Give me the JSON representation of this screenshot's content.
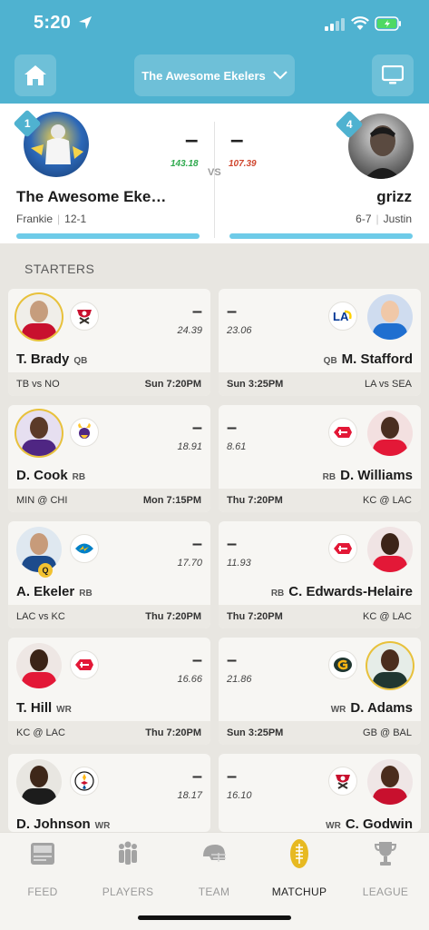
{
  "status_bar": {
    "time": "5:20"
  },
  "header": {
    "team_select_label": "The Awesome Ekelers"
  },
  "matchup": {
    "left": {
      "rank": "1",
      "score": "–",
      "projected": "143.18",
      "team_name": "The Awesome Eke…",
      "owner": "Frankie",
      "record": "12-1",
      "progress": 1.0
    },
    "vs": "VS",
    "right": {
      "rank": "4",
      "score": "–",
      "projected": "107.39",
      "team_name": "grizz",
      "owner": "Justin",
      "record": "6-7",
      "progress": 1.0
    }
  },
  "section": {
    "label": "STARTERS"
  },
  "rows": [
    {
      "left": {
        "name": "T. Brady",
        "pos": "QB",
        "score": "–",
        "proj": "24.39",
        "matchup": "TB vs NO",
        "time": "Sun 7:20PM",
        "team_logo": "buccaneers-logo",
        "highlight": true
      },
      "right": {
        "name": "M. Stafford",
        "pos": "QB",
        "score": "–",
        "proj": "23.06",
        "matchup": "LA vs SEA",
        "time": "Sun 3:25PM",
        "team_logo": "rams-logo",
        "highlight": false
      }
    },
    {
      "left": {
        "name": "D. Cook",
        "pos": "RB",
        "score": "–",
        "proj": "18.91",
        "matchup": "MIN @ CHI",
        "time": "Mon 7:15PM",
        "team_logo": "vikings-logo",
        "highlight": true
      },
      "right": {
        "name": "D. Williams",
        "pos": "RB",
        "score": "–",
        "proj": "8.61",
        "matchup": "KC @ LAC",
        "time": "Thu 7:20PM",
        "team_logo": "chiefs-logo",
        "highlight": false
      }
    },
    {
      "left": {
        "name": "A. Ekeler",
        "pos": "RB",
        "score": "–",
        "proj": "17.70",
        "matchup": "LAC vs KC",
        "time": "Thu 7:20PM",
        "team_logo": "chargers-logo",
        "highlight": false,
        "badge": "Q"
      },
      "right": {
        "name": "C. Edwards-Helaire",
        "pos": "RB",
        "score": "–",
        "proj": "11.93",
        "matchup": "KC @ LAC",
        "time": "Thu 7:20PM",
        "team_logo": "chiefs-logo",
        "highlight": false
      }
    },
    {
      "left": {
        "name": "T. Hill",
        "pos": "WR",
        "score": "–",
        "proj": "16.66",
        "matchup": "KC @ LAC",
        "time": "Thu 7:20PM",
        "team_logo": "chiefs-logo",
        "highlight": false
      },
      "right": {
        "name": "D. Adams",
        "pos": "WR",
        "score": "–",
        "proj": "21.86",
        "matchup": "GB @ BAL",
        "time": "Sun 3:25PM",
        "team_logo": "packers-logo",
        "highlight": true
      }
    },
    {
      "left": {
        "name": "D. Johnson",
        "pos": "WR",
        "score": "–",
        "proj": "18.17",
        "team_logo": "steelers-logo",
        "highlight": false
      },
      "right": {
        "name": "C. Godwin",
        "pos": "WR",
        "score": "–",
        "proj": "16.10",
        "team_logo": "buccaneers-logo",
        "highlight": false
      }
    }
  ],
  "tabs": [
    {
      "label": "FEED",
      "icon": "feed-icon",
      "active": false
    },
    {
      "label": "PLAYERS",
      "icon": "players-icon",
      "active": false
    },
    {
      "label": "TEAM",
      "icon": "helmet-icon",
      "active": false
    },
    {
      "label": "MATCHUP",
      "icon": "football-icon",
      "active": true
    },
    {
      "label": "LEAGUE",
      "icon": "trophy-icon",
      "active": false
    }
  ],
  "colors": {
    "brand_blue": "#4fb2d0",
    "proj_green": "#2ea94d",
    "proj_red": "#d0462e",
    "highlight_gold": "#e8c13b"
  }
}
